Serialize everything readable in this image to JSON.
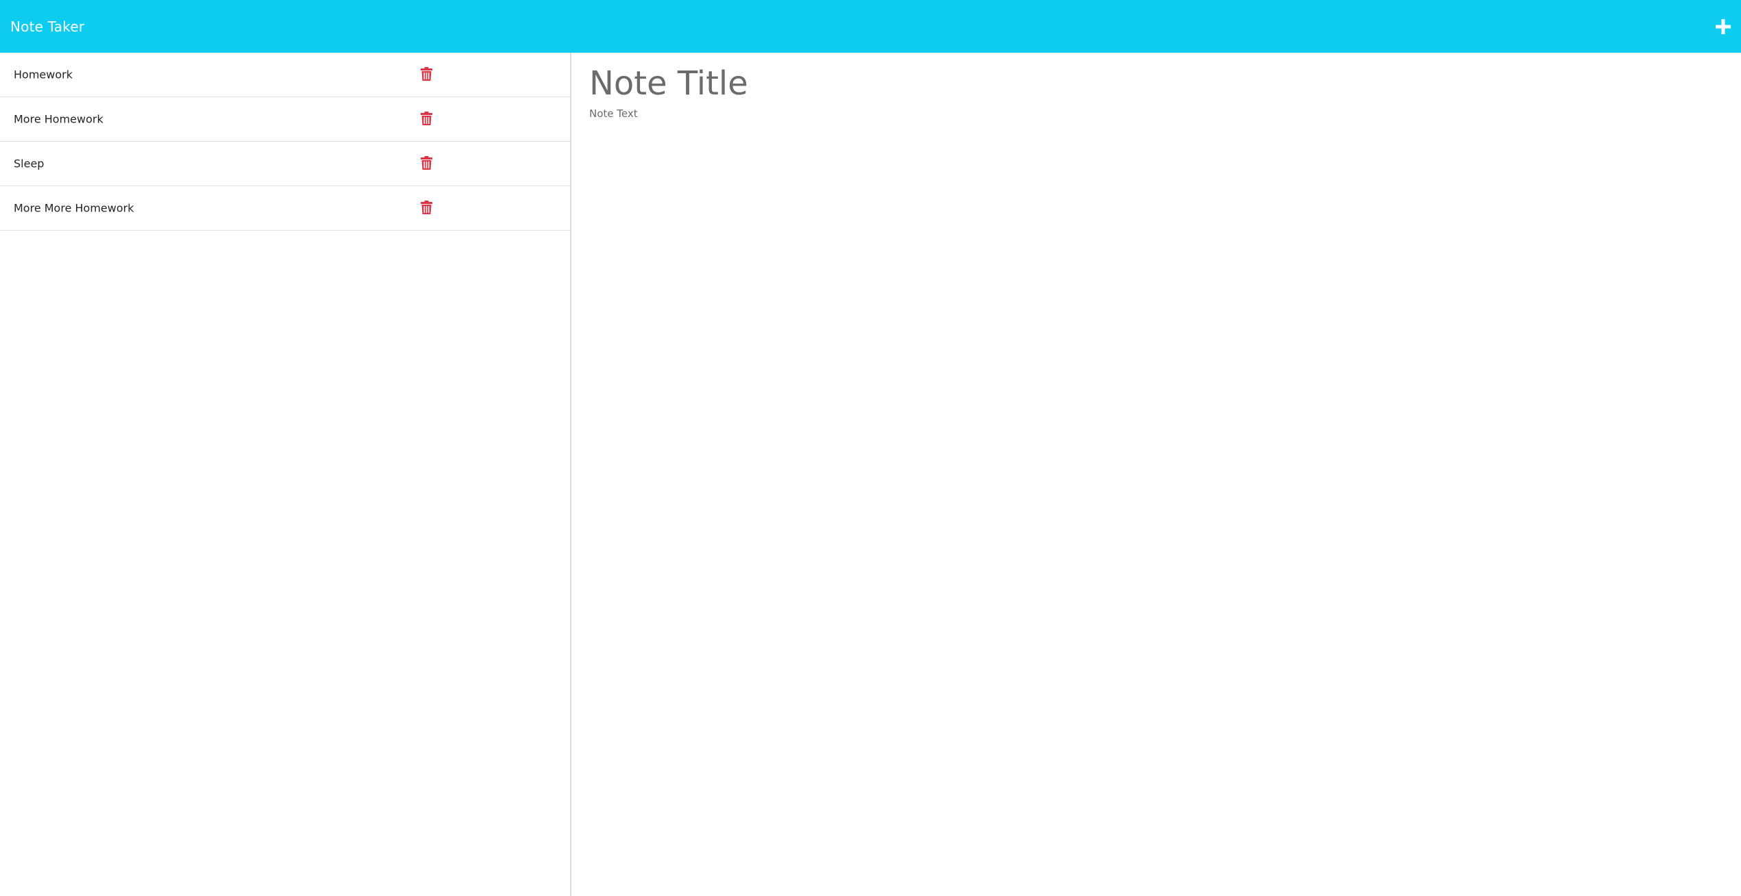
{
  "app": {
    "title": "Note Taker",
    "accent_color": "#0ecbf0",
    "new_note_icon": "plus-icon"
  },
  "notes": [
    {
      "label": "Homework",
      "delete_icon": "trash-icon"
    },
    {
      "label": "More Homework",
      "delete_icon": "trash-icon"
    },
    {
      "label": "Sleep",
      "delete_icon": "trash-icon"
    },
    {
      "label": "More More Homework",
      "delete_icon": "trash-icon"
    }
  ],
  "editor": {
    "title_value": "",
    "title_placeholder": "Note Title",
    "text_value": "",
    "text_placeholder": "Note Text"
  },
  "colors": {
    "delete": "#dc3545",
    "placeholder": "#6b6b6b"
  }
}
